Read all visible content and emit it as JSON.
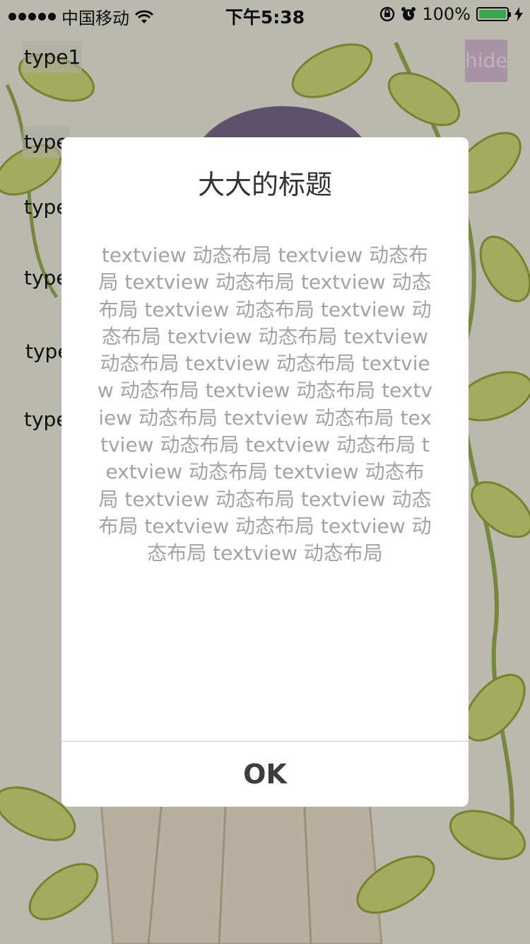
{
  "status_bar": {
    "carrier": "中国移动",
    "time": "下午5:38",
    "battery_percent": "100%",
    "battery_level": 1.0,
    "battery_color": "#4cd964"
  },
  "buttons": {
    "type1": "type1",
    "type2": "type",
    "type3": "type",
    "type4": "type",
    "type5": "type",
    "type6": "type",
    "hide": "hide"
  },
  "dialog": {
    "title": "大大的标题",
    "message": "textview 动态布局 textview 动态布局 textview 动态布局 textview 动态布局 textview 动态布局 textview 动态布局 textview 动态布局 textview 动态布局 textview 动态布局 textview 动态布局 textview 动态布局 textview 动态布局 textview 动态布局 textview 动态布局 textview 动态布局 textview 动态布局 textview 动态布局 textview 动态布局 textview 动态布局 textview 动态布局 textview 动态布局 textview 动态布局",
    "ok_label": "OK"
  },
  "icons": [
    "wifi-icon",
    "rotation-lock-icon",
    "alarm-icon",
    "battery-icon",
    "charging-icon"
  ]
}
